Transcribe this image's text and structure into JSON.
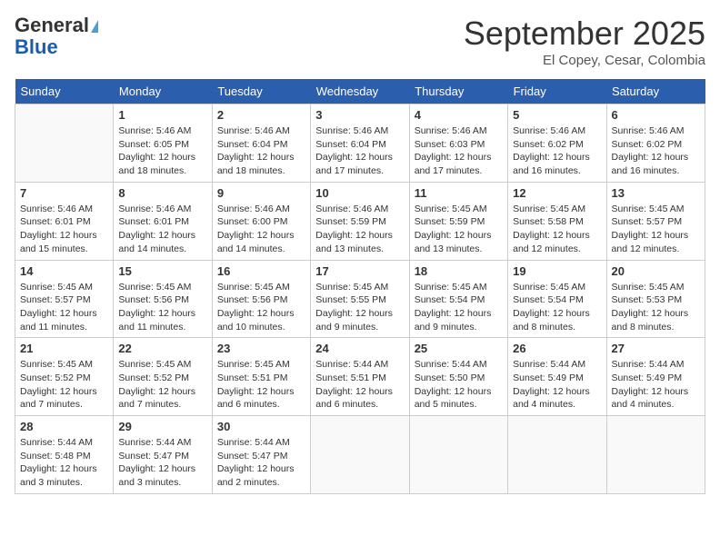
{
  "header": {
    "logo_general": "General",
    "logo_blue": "Blue",
    "month": "September 2025",
    "location": "El Copey, Cesar, Colombia"
  },
  "days_of_week": [
    "Sunday",
    "Monday",
    "Tuesday",
    "Wednesday",
    "Thursday",
    "Friday",
    "Saturday"
  ],
  "weeks": [
    [
      {
        "day": "",
        "info": ""
      },
      {
        "day": "1",
        "info": "Sunrise: 5:46 AM\nSunset: 6:05 PM\nDaylight: 12 hours\nand 18 minutes."
      },
      {
        "day": "2",
        "info": "Sunrise: 5:46 AM\nSunset: 6:04 PM\nDaylight: 12 hours\nand 18 minutes."
      },
      {
        "day": "3",
        "info": "Sunrise: 5:46 AM\nSunset: 6:04 PM\nDaylight: 12 hours\nand 17 minutes."
      },
      {
        "day": "4",
        "info": "Sunrise: 5:46 AM\nSunset: 6:03 PM\nDaylight: 12 hours\nand 17 minutes."
      },
      {
        "day": "5",
        "info": "Sunrise: 5:46 AM\nSunset: 6:02 PM\nDaylight: 12 hours\nand 16 minutes."
      },
      {
        "day": "6",
        "info": "Sunrise: 5:46 AM\nSunset: 6:02 PM\nDaylight: 12 hours\nand 16 minutes."
      }
    ],
    [
      {
        "day": "7",
        "info": "Sunrise: 5:46 AM\nSunset: 6:01 PM\nDaylight: 12 hours\nand 15 minutes."
      },
      {
        "day": "8",
        "info": "Sunrise: 5:46 AM\nSunset: 6:01 PM\nDaylight: 12 hours\nand 14 minutes."
      },
      {
        "day": "9",
        "info": "Sunrise: 5:46 AM\nSunset: 6:00 PM\nDaylight: 12 hours\nand 14 minutes."
      },
      {
        "day": "10",
        "info": "Sunrise: 5:46 AM\nSunset: 5:59 PM\nDaylight: 12 hours\nand 13 minutes."
      },
      {
        "day": "11",
        "info": "Sunrise: 5:45 AM\nSunset: 5:59 PM\nDaylight: 12 hours\nand 13 minutes."
      },
      {
        "day": "12",
        "info": "Sunrise: 5:45 AM\nSunset: 5:58 PM\nDaylight: 12 hours\nand 12 minutes."
      },
      {
        "day": "13",
        "info": "Sunrise: 5:45 AM\nSunset: 5:57 PM\nDaylight: 12 hours\nand 12 minutes."
      }
    ],
    [
      {
        "day": "14",
        "info": "Sunrise: 5:45 AM\nSunset: 5:57 PM\nDaylight: 12 hours\nand 11 minutes."
      },
      {
        "day": "15",
        "info": "Sunrise: 5:45 AM\nSunset: 5:56 PM\nDaylight: 12 hours\nand 11 minutes."
      },
      {
        "day": "16",
        "info": "Sunrise: 5:45 AM\nSunset: 5:56 PM\nDaylight: 12 hours\nand 10 minutes."
      },
      {
        "day": "17",
        "info": "Sunrise: 5:45 AM\nSunset: 5:55 PM\nDaylight: 12 hours\nand 9 minutes."
      },
      {
        "day": "18",
        "info": "Sunrise: 5:45 AM\nSunset: 5:54 PM\nDaylight: 12 hours\nand 9 minutes."
      },
      {
        "day": "19",
        "info": "Sunrise: 5:45 AM\nSunset: 5:54 PM\nDaylight: 12 hours\nand 8 minutes."
      },
      {
        "day": "20",
        "info": "Sunrise: 5:45 AM\nSunset: 5:53 PM\nDaylight: 12 hours\nand 8 minutes."
      }
    ],
    [
      {
        "day": "21",
        "info": "Sunrise: 5:45 AM\nSunset: 5:52 PM\nDaylight: 12 hours\nand 7 minutes."
      },
      {
        "day": "22",
        "info": "Sunrise: 5:45 AM\nSunset: 5:52 PM\nDaylight: 12 hours\nand 7 minutes."
      },
      {
        "day": "23",
        "info": "Sunrise: 5:45 AM\nSunset: 5:51 PM\nDaylight: 12 hours\nand 6 minutes."
      },
      {
        "day": "24",
        "info": "Sunrise: 5:44 AM\nSunset: 5:51 PM\nDaylight: 12 hours\nand 6 minutes."
      },
      {
        "day": "25",
        "info": "Sunrise: 5:44 AM\nSunset: 5:50 PM\nDaylight: 12 hours\nand 5 minutes."
      },
      {
        "day": "26",
        "info": "Sunrise: 5:44 AM\nSunset: 5:49 PM\nDaylight: 12 hours\nand 4 minutes."
      },
      {
        "day": "27",
        "info": "Sunrise: 5:44 AM\nSunset: 5:49 PM\nDaylight: 12 hours\nand 4 minutes."
      }
    ],
    [
      {
        "day": "28",
        "info": "Sunrise: 5:44 AM\nSunset: 5:48 PM\nDaylight: 12 hours\nand 3 minutes."
      },
      {
        "day": "29",
        "info": "Sunrise: 5:44 AM\nSunset: 5:47 PM\nDaylight: 12 hours\nand 3 minutes."
      },
      {
        "day": "30",
        "info": "Sunrise: 5:44 AM\nSunset: 5:47 PM\nDaylight: 12 hours\nand 2 minutes."
      },
      {
        "day": "",
        "info": ""
      },
      {
        "day": "",
        "info": ""
      },
      {
        "day": "",
        "info": ""
      },
      {
        "day": "",
        "info": ""
      }
    ]
  ]
}
